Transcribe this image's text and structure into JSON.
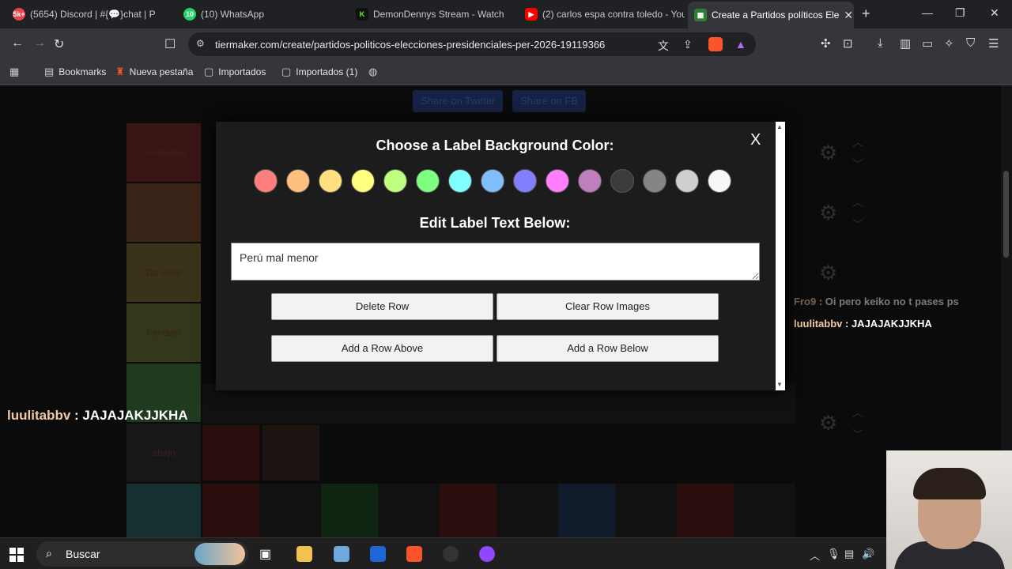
{
  "browser": {
    "tabs": [
      {
        "title": "(5654) Discord | #{💬}chat | P",
        "icon_color": "#ed4245",
        "badge": "5k+"
      },
      {
        "title": "(10) WhatsApp",
        "icon_color": "#25d366",
        "badge": "10"
      },
      {
        "title": "DemonDennys Stream - Watch",
        "icon_color": "#53fc18",
        "badge": "K"
      },
      {
        "title": "(2) carlos espa contra toledo - You",
        "icon_color": "#ff0000",
        "badge": "▶"
      },
      {
        "title": "Create a Partidos políticos Ele",
        "icon_color": "#2e7d32",
        "badge": "▦",
        "active": true
      }
    ],
    "new_tab": "+",
    "window_controls": {
      "minimize": "—",
      "maximize": "❐",
      "close": "✕"
    },
    "url": "tiermaker.com/create/partidos-politicos-elecciones-presidenciales-per-2026-19119366",
    "extension_badge": "5",
    "bookmarks": [
      {
        "label": "Bookmarks",
        "icon": "bookmark-icon"
      },
      {
        "label": "Nueva pestaña",
        "icon": "brave-icon"
      },
      {
        "label": "Importados",
        "icon": "folder-icon"
      },
      {
        "label": "Importados (1)",
        "icon": "folder-icon"
      }
    ]
  },
  "page": {
    "share_buttons": [
      "Share on Twitter",
      "Share on FB"
    ],
    "tiers": [
      {
        "label": "Si Pasaaa",
        "color": "#3a1515"
      },
      {
        "label": "Peru mal menor",
        "color": "#3a2418"
      },
      {
        "label": "Da shoe",
        "color": "#39331a"
      },
      {
        "label": "Pendejo",
        "color": "#33381a"
      },
      {
        "label": "",
        "color": "#1f3a1f"
      },
      {
        "label": "abajo",
        "color": "#171717"
      },
      {
        "label": "",
        "color": "#163032"
      }
    ]
  },
  "chat": {
    "left": {
      "user": "luulitabbv",
      "message": "JAJAJAKJJKHA"
    },
    "right": [
      {
        "user": "Fro9",
        "message": "Oi pero keiko no t pases ps",
        "faded": true
      },
      {
        "user": "luulitabbv",
        "message": "JAJAJAKJJKHA",
        "faded": false
      }
    ]
  },
  "modal": {
    "title": "Choose a Label Background Color:",
    "close_label": "X",
    "swatches": [
      "#ff7f7f",
      "#ffbf7f",
      "#ffdf7f",
      "#ffff7f",
      "#bfff7f",
      "#7fff7f",
      "#7fffff",
      "#7fbfff",
      "#7f7fff",
      "#ff7fff",
      "#bf7fbf",
      "#3b3b3b",
      "#858585",
      "#cfcfcf",
      "#f7f7f7"
    ],
    "edit_title": "Edit Label Text Below:",
    "label_text": "Perú mal menor",
    "buttons": {
      "delete_row": "Delete Row",
      "clear_row_images": "Clear Row Images",
      "add_row_above": "Add a Row Above",
      "add_row_below": "Add a Row Below"
    }
  },
  "taskbar": {
    "search_placeholder": "Buscar"
  }
}
